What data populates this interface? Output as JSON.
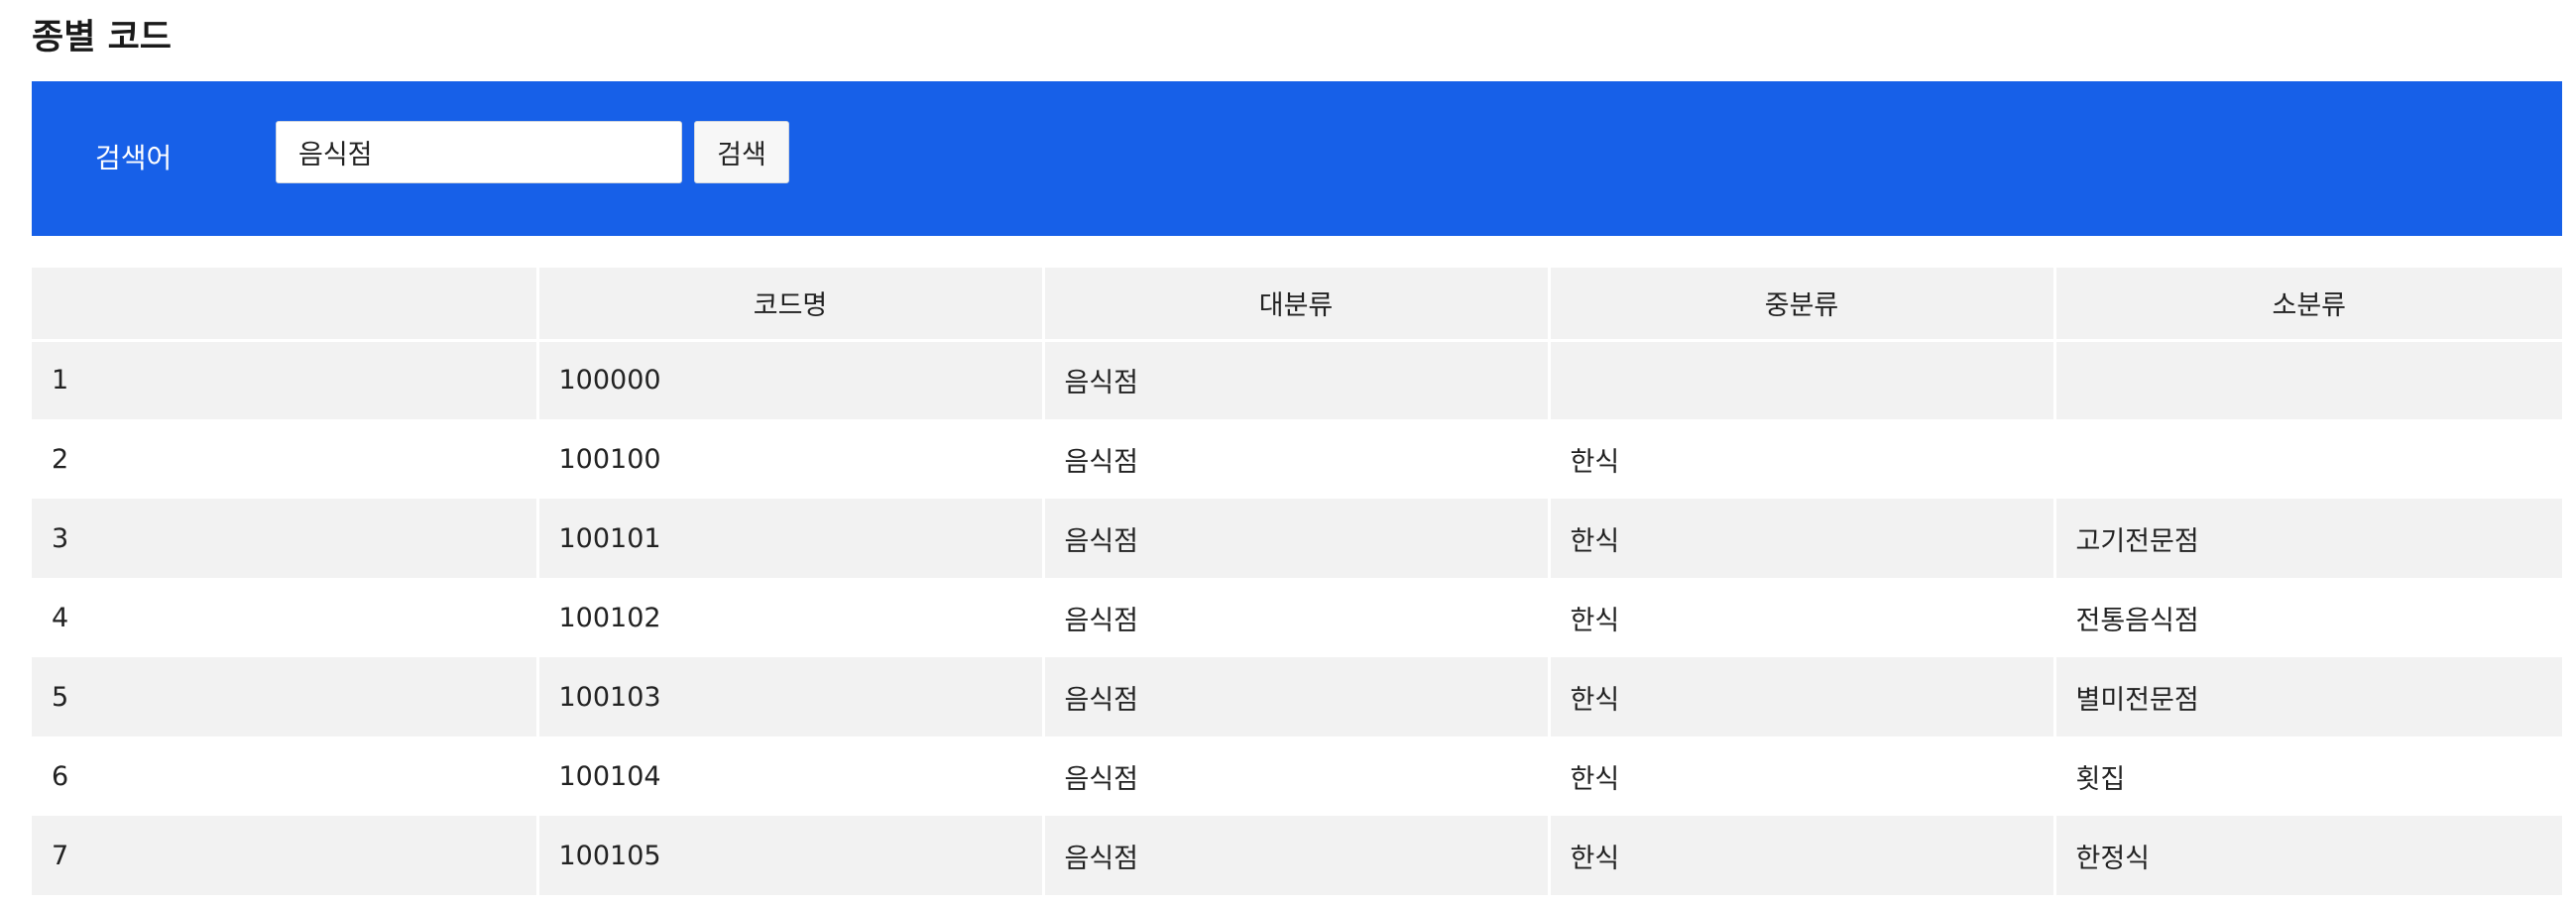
{
  "page": {
    "title": "종별 코드"
  },
  "search": {
    "label": "검색어",
    "value": "음식점",
    "button_label": "검색"
  },
  "table": {
    "headers": [
      "",
      "코드명",
      "대분류",
      "중분류",
      "소분류"
    ],
    "rows": [
      [
        "1",
        "100000",
        "음식점",
        "",
        ""
      ],
      [
        "2",
        "100100",
        "음식점",
        "한식",
        ""
      ],
      [
        "3",
        "100101",
        "음식점",
        "한식",
        "고기전문점"
      ],
      [
        "4",
        "100102",
        "음식점",
        "한식",
        "전통음식점"
      ],
      [
        "5",
        "100103",
        "음식점",
        "한식",
        "별미전문점"
      ],
      [
        "6",
        "100104",
        "음식점",
        "한식",
        "횟집"
      ],
      [
        "7",
        "100105",
        "음식점",
        "한식",
        "한정식"
      ]
    ]
  },
  "colors": {
    "accent": "#1760e8",
    "row_alt": "#f2f2f2"
  }
}
